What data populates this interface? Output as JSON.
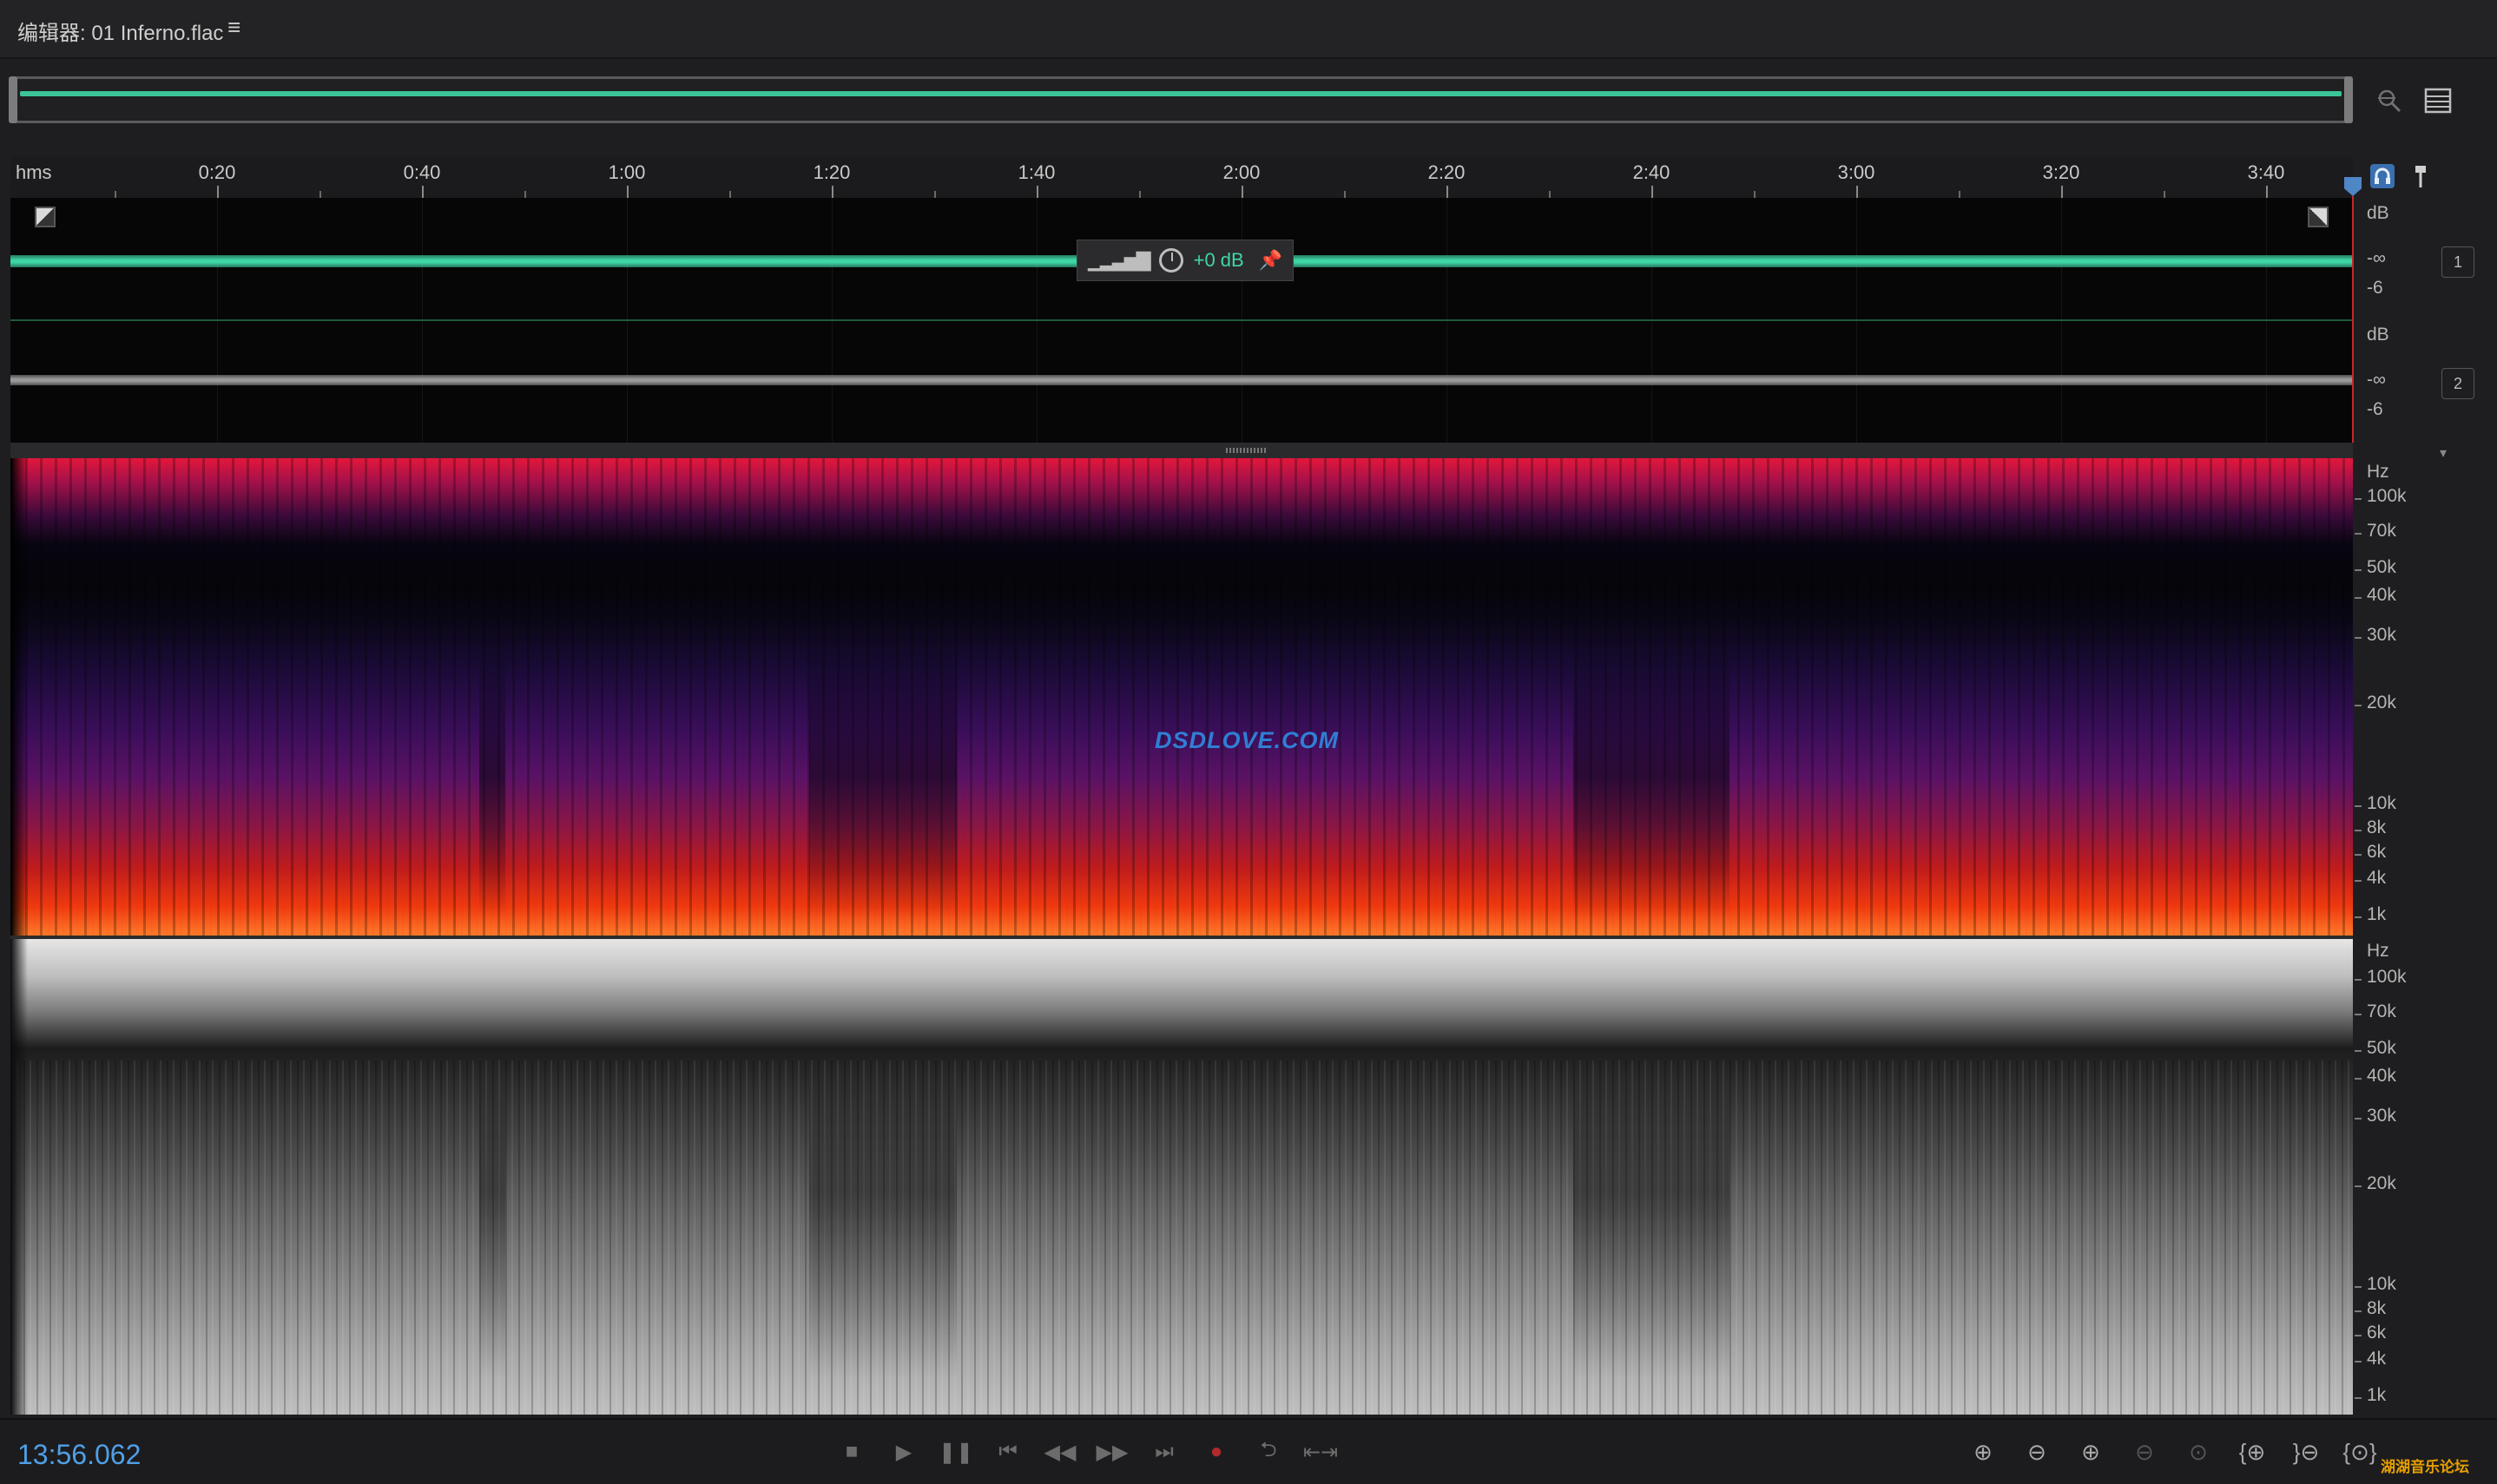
{
  "header": {
    "title": "编辑器: 01 Inferno.flac",
    "menu_icon": "≡"
  },
  "ruler": {
    "unit": "hms",
    "labels": [
      "0:20",
      "0:40",
      "1:00",
      "1:20",
      "1:40",
      "2:00",
      "2:20",
      "2:40",
      "3:00",
      "3:20",
      "3:40"
    ]
  },
  "hud": {
    "gain": "+0 dB"
  },
  "channels": [
    {
      "badge": "1",
      "db_unit": "dB",
      "db_inf": "-∞",
      "db_minus6": "-6"
    },
    {
      "badge": "2",
      "db_unit": "dB",
      "db_inf": "-∞",
      "db_minus6": "-6"
    }
  ],
  "freq_scale": {
    "unit": "Hz",
    "labels": [
      "100k",
      "70k",
      "50k",
      "40k",
      "30k",
      "20k",
      "10k",
      "8k",
      "6k",
      "4k",
      "1k"
    ]
  },
  "watermark": "DSDLOVE.COM",
  "timecode": "13:56.062",
  "forum_mark": "湖湖音乐论坛",
  "colors": {
    "wave_green": "#3fd6a6",
    "playhead_red": "#c62828",
    "timecode_blue": "#4f9fe6",
    "record_red": "#b22a2a"
  }
}
